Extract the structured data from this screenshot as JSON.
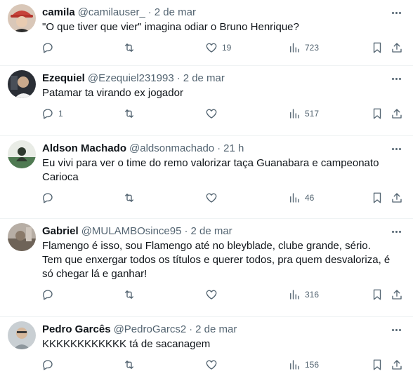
{
  "replies": [
    {
      "name": "camila",
      "handle": "@camilauser_",
      "date": "2 de mar",
      "text": "\"O que tiver que vier\" imagina odiar o Bruno Henrique?",
      "reply_count": "",
      "like_count": "19",
      "view_count": "723",
      "avatar_color": "#c6423a"
    },
    {
      "name": "Ezequiel",
      "handle": "@Ezequiel231993",
      "date": "2 de mar",
      "text": "Patamar ta virando ex jogador",
      "reply_count": "1",
      "like_count": "",
      "view_count": "517",
      "avatar_color": "#3b3f46"
    },
    {
      "name": "Aldson Machado",
      "handle": "@aldsonmachado",
      "date": "21 h",
      "text": "Eu vivi para ver o time do remo valorizar taça Guanabara e campeonato Carioca",
      "reply_count": "",
      "like_count": "",
      "view_count": "46",
      "avatar_color": "#4f7a52"
    },
    {
      "name": "Gabriel",
      "handle": "@MULAMBOsince95",
      "date": "2 de mar",
      "text": "Flamengo é isso, sou Flamengo até no bleyblade, clube grande, sério. Tem que enxergar todos os títulos e querer todos, pra quem desvaloriza, é só chegar lá e ganhar!",
      "reply_count": "",
      "like_count": "",
      "view_count": "316",
      "avatar_color": "#8a7a6a"
    },
    {
      "name": "Pedro Garcês",
      "handle": "@PedroGarcs2",
      "date": "2 de mar",
      "text": "KKKKKKKKKKKK tá de sacanagem",
      "reply_count": "",
      "like_count": "",
      "view_count": "156",
      "avatar_color": "#9aa3a8"
    }
  ],
  "icons": {
    "reply": "reply-icon",
    "retweet": "retweet-icon",
    "like": "heart-icon",
    "views": "views-icon",
    "bookmark": "bookmark-icon",
    "share": "share-icon",
    "more": "more-icon"
  },
  "colors": {
    "text": "#0f1419",
    "secondary": "#536471",
    "divider": "#eff3f4"
  }
}
